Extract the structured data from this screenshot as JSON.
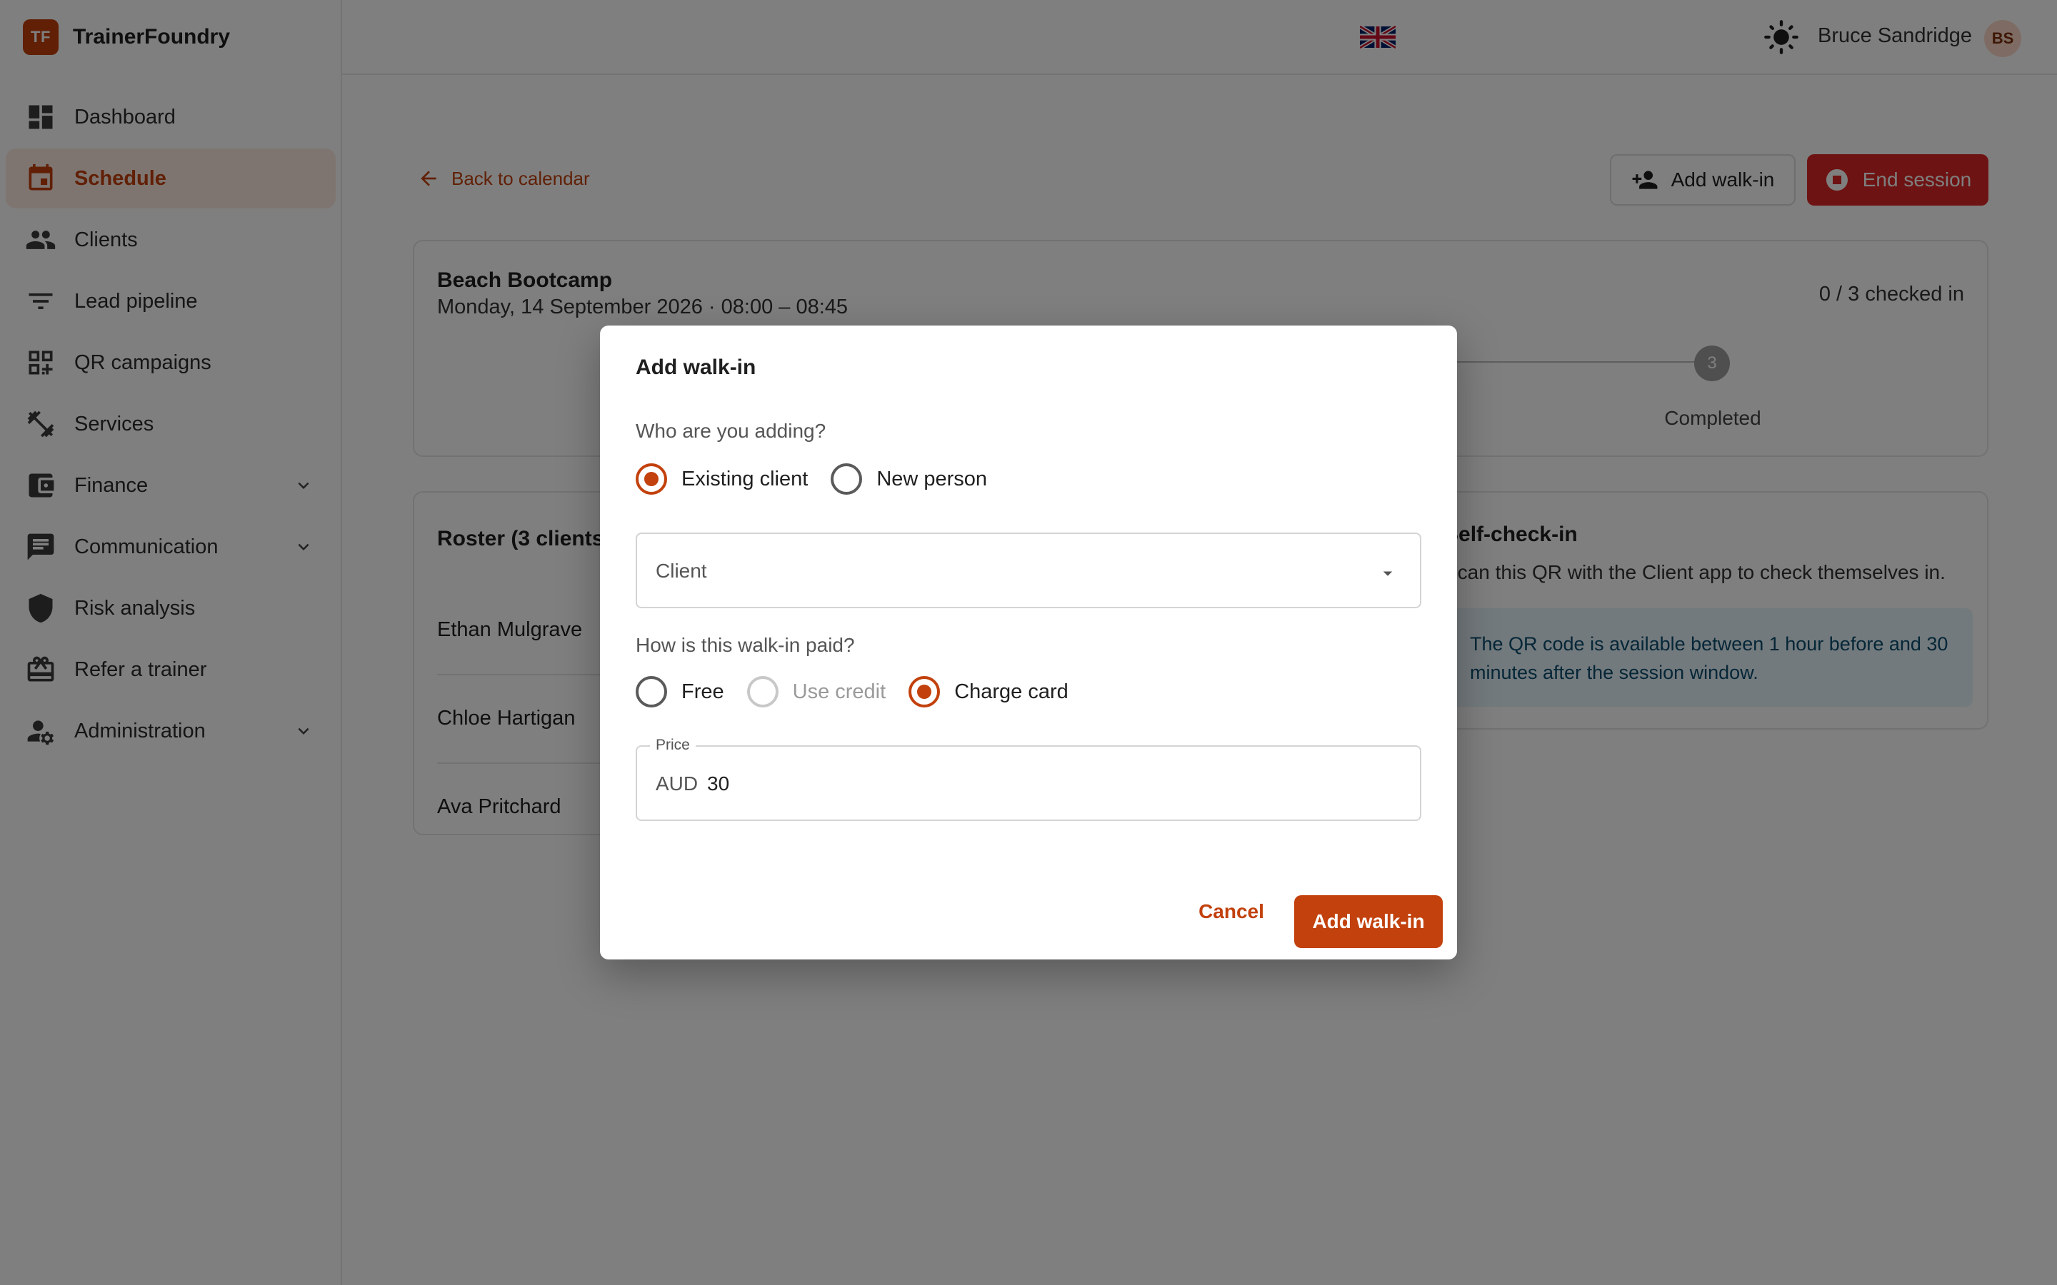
{
  "app": {
    "logo_initials": "TF",
    "name": "TrainerFoundry"
  },
  "sidebar": {
    "items": [
      {
        "label": "Dashboard",
        "icon": "dashboard-icon"
      },
      {
        "label": "Schedule",
        "icon": "calendar-icon",
        "active": true
      },
      {
        "label": "Clients",
        "icon": "people-icon"
      },
      {
        "label": "Lead pipeline",
        "icon": "filter-icon"
      },
      {
        "label": "QR campaigns",
        "icon": "qr-code-icon"
      },
      {
        "label": "Services",
        "icon": "dumbbell-icon"
      },
      {
        "label": "Finance",
        "icon": "wallet-icon",
        "expandable": true
      },
      {
        "label": "Communication",
        "icon": "chat-icon",
        "expandable": true
      },
      {
        "label": "Risk analysis",
        "icon": "shield-icon"
      },
      {
        "label": "Refer a trainer",
        "icon": "gift-icon"
      },
      {
        "label": "Administration",
        "icon": "admin-icon",
        "expandable": true
      }
    ]
  },
  "header": {
    "user_name": "Bruce Sandridge",
    "user_initials": "BS",
    "language_icon": "uk-flag-icon",
    "theme_icon": "sun-icon"
  },
  "page": {
    "back_label": "Back to calendar",
    "add_walkin_label": "Add walk-in",
    "end_session_label": "End session",
    "session": {
      "title": "Beach Bootcamp",
      "datetime": "Monday, 14 September 2026 · 08:00 – 08:45",
      "checked_in": "0 / 3 checked in",
      "step_number": "3",
      "step_label": "Completed"
    },
    "roster": {
      "title": "Roster (3 clients)",
      "clients": [
        "Ethan Mulgrave",
        "Chloe Hartigan",
        "Ava Pritchard"
      ]
    },
    "self_checkin": {
      "title": "Self-check-in",
      "subtitle": "Scan this QR with the Client app to check themselves in.",
      "info": "The QR code is available between 1 hour before and 30 minutes after the session window."
    }
  },
  "modal": {
    "title": "Add walk-in",
    "who_label": "Who are you adding?",
    "who_options": [
      {
        "label": "Existing client",
        "checked": true
      },
      {
        "label": "New person",
        "checked": false
      }
    ],
    "client_select_value": "Client",
    "paid_label": "How is this walk-in paid?",
    "paid_options": [
      {
        "label": "Free",
        "checked": false,
        "disabled": false
      },
      {
        "label": "Use credit",
        "checked": false,
        "disabled": true
      },
      {
        "label": "Charge card",
        "checked": true,
        "disabled": false
      }
    ],
    "price_legend": "Price",
    "price_currency": "AUD",
    "price_value": "30",
    "cancel_label": "Cancel",
    "submit_label": "Add walk-in"
  },
  "colors": {
    "accent": "#c2410c",
    "danger": "#dc2626",
    "info_bg": "#e6f4fb"
  }
}
